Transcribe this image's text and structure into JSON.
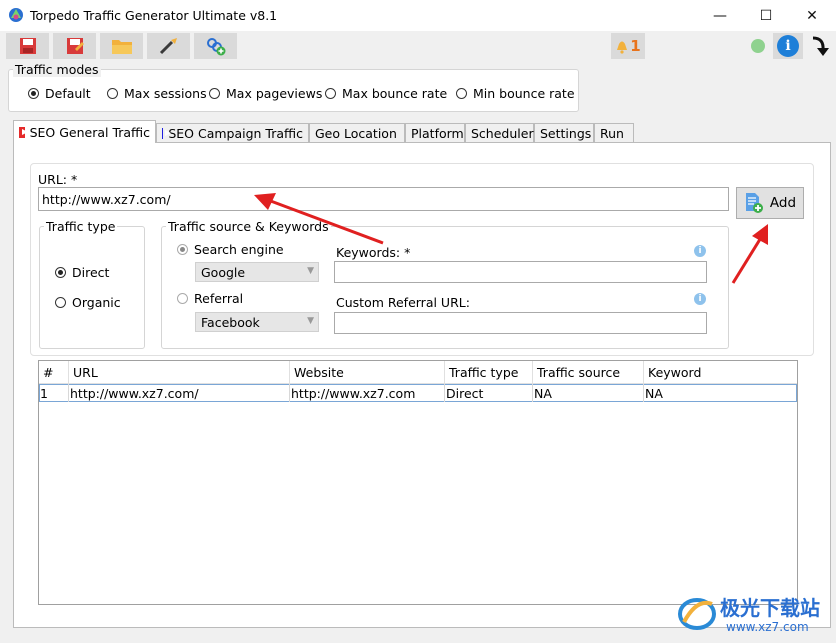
{
  "window": {
    "title": "Torpedo Traffic Generator Ultimate v8.1",
    "minimize_glyph": "—",
    "maximize_glyph": "☐",
    "close_glyph": "✕"
  },
  "toolbar": {
    "buttons": [
      "save-icon",
      "save-as-icon",
      "open-folder-icon",
      "clean-icon",
      "proxy-icon"
    ],
    "notification_count": "1",
    "status_color": "#8fd28f",
    "info_color": "#1e7fd8"
  },
  "traffic_modes": {
    "label": "Traffic modes",
    "options": [
      "Default",
      "Max sessions",
      "Max pageviews",
      "Max bounce rate",
      "Min bounce rate"
    ],
    "selected": "Default"
  },
  "tabs": [
    "SEO General Traffic",
    "SEO Campaign Traffic",
    "Geo Location",
    "Platform",
    "Scheduler",
    "Settings",
    "Run"
  ],
  "active_tab": "SEO General Traffic",
  "form": {
    "url_label": "URL: *",
    "url_value": "http://www.xz7.com/",
    "add_label": "Add",
    "traffic_type": {
      "label": "Traffic type",
      "options": [
        "Direct",
        "Organic"
      ],
      "selected": "Direct"
    },
    "source": {
      "label": "Traffic source & Keywords",
      "search_engine_label": "Search engine",
      "search_engine_value": "Google",
      "referral_label": "Referral",
      "referral_value": "Facebook",
      "keywords_label": "Keywords: *",
      "keywords_value": "",
      "custom_referral_label": "Custom Referral URL:",
      "custom_referral_value": ""
    }
  },
  "table": {
    "columns": [
      "#",
      "URL",
      "Website",
      "Traffic type",
      "Traffic source",
      "Keyword"
    ],
    "rows": [
      [
        "1",
        "http://www.xz7.com/",
        "http://www.xz7.com",
        "Direct",
        "NA",
        "NA"
      ]
    ]
  },
  "watermark": {
    "brand": "极光下载站",
    "url": "www.xz7.com"
  },
  "colors": {
    "annotation_arrow": "#e02020",
    "selection_border": "#7aa6d6"
  }
}
